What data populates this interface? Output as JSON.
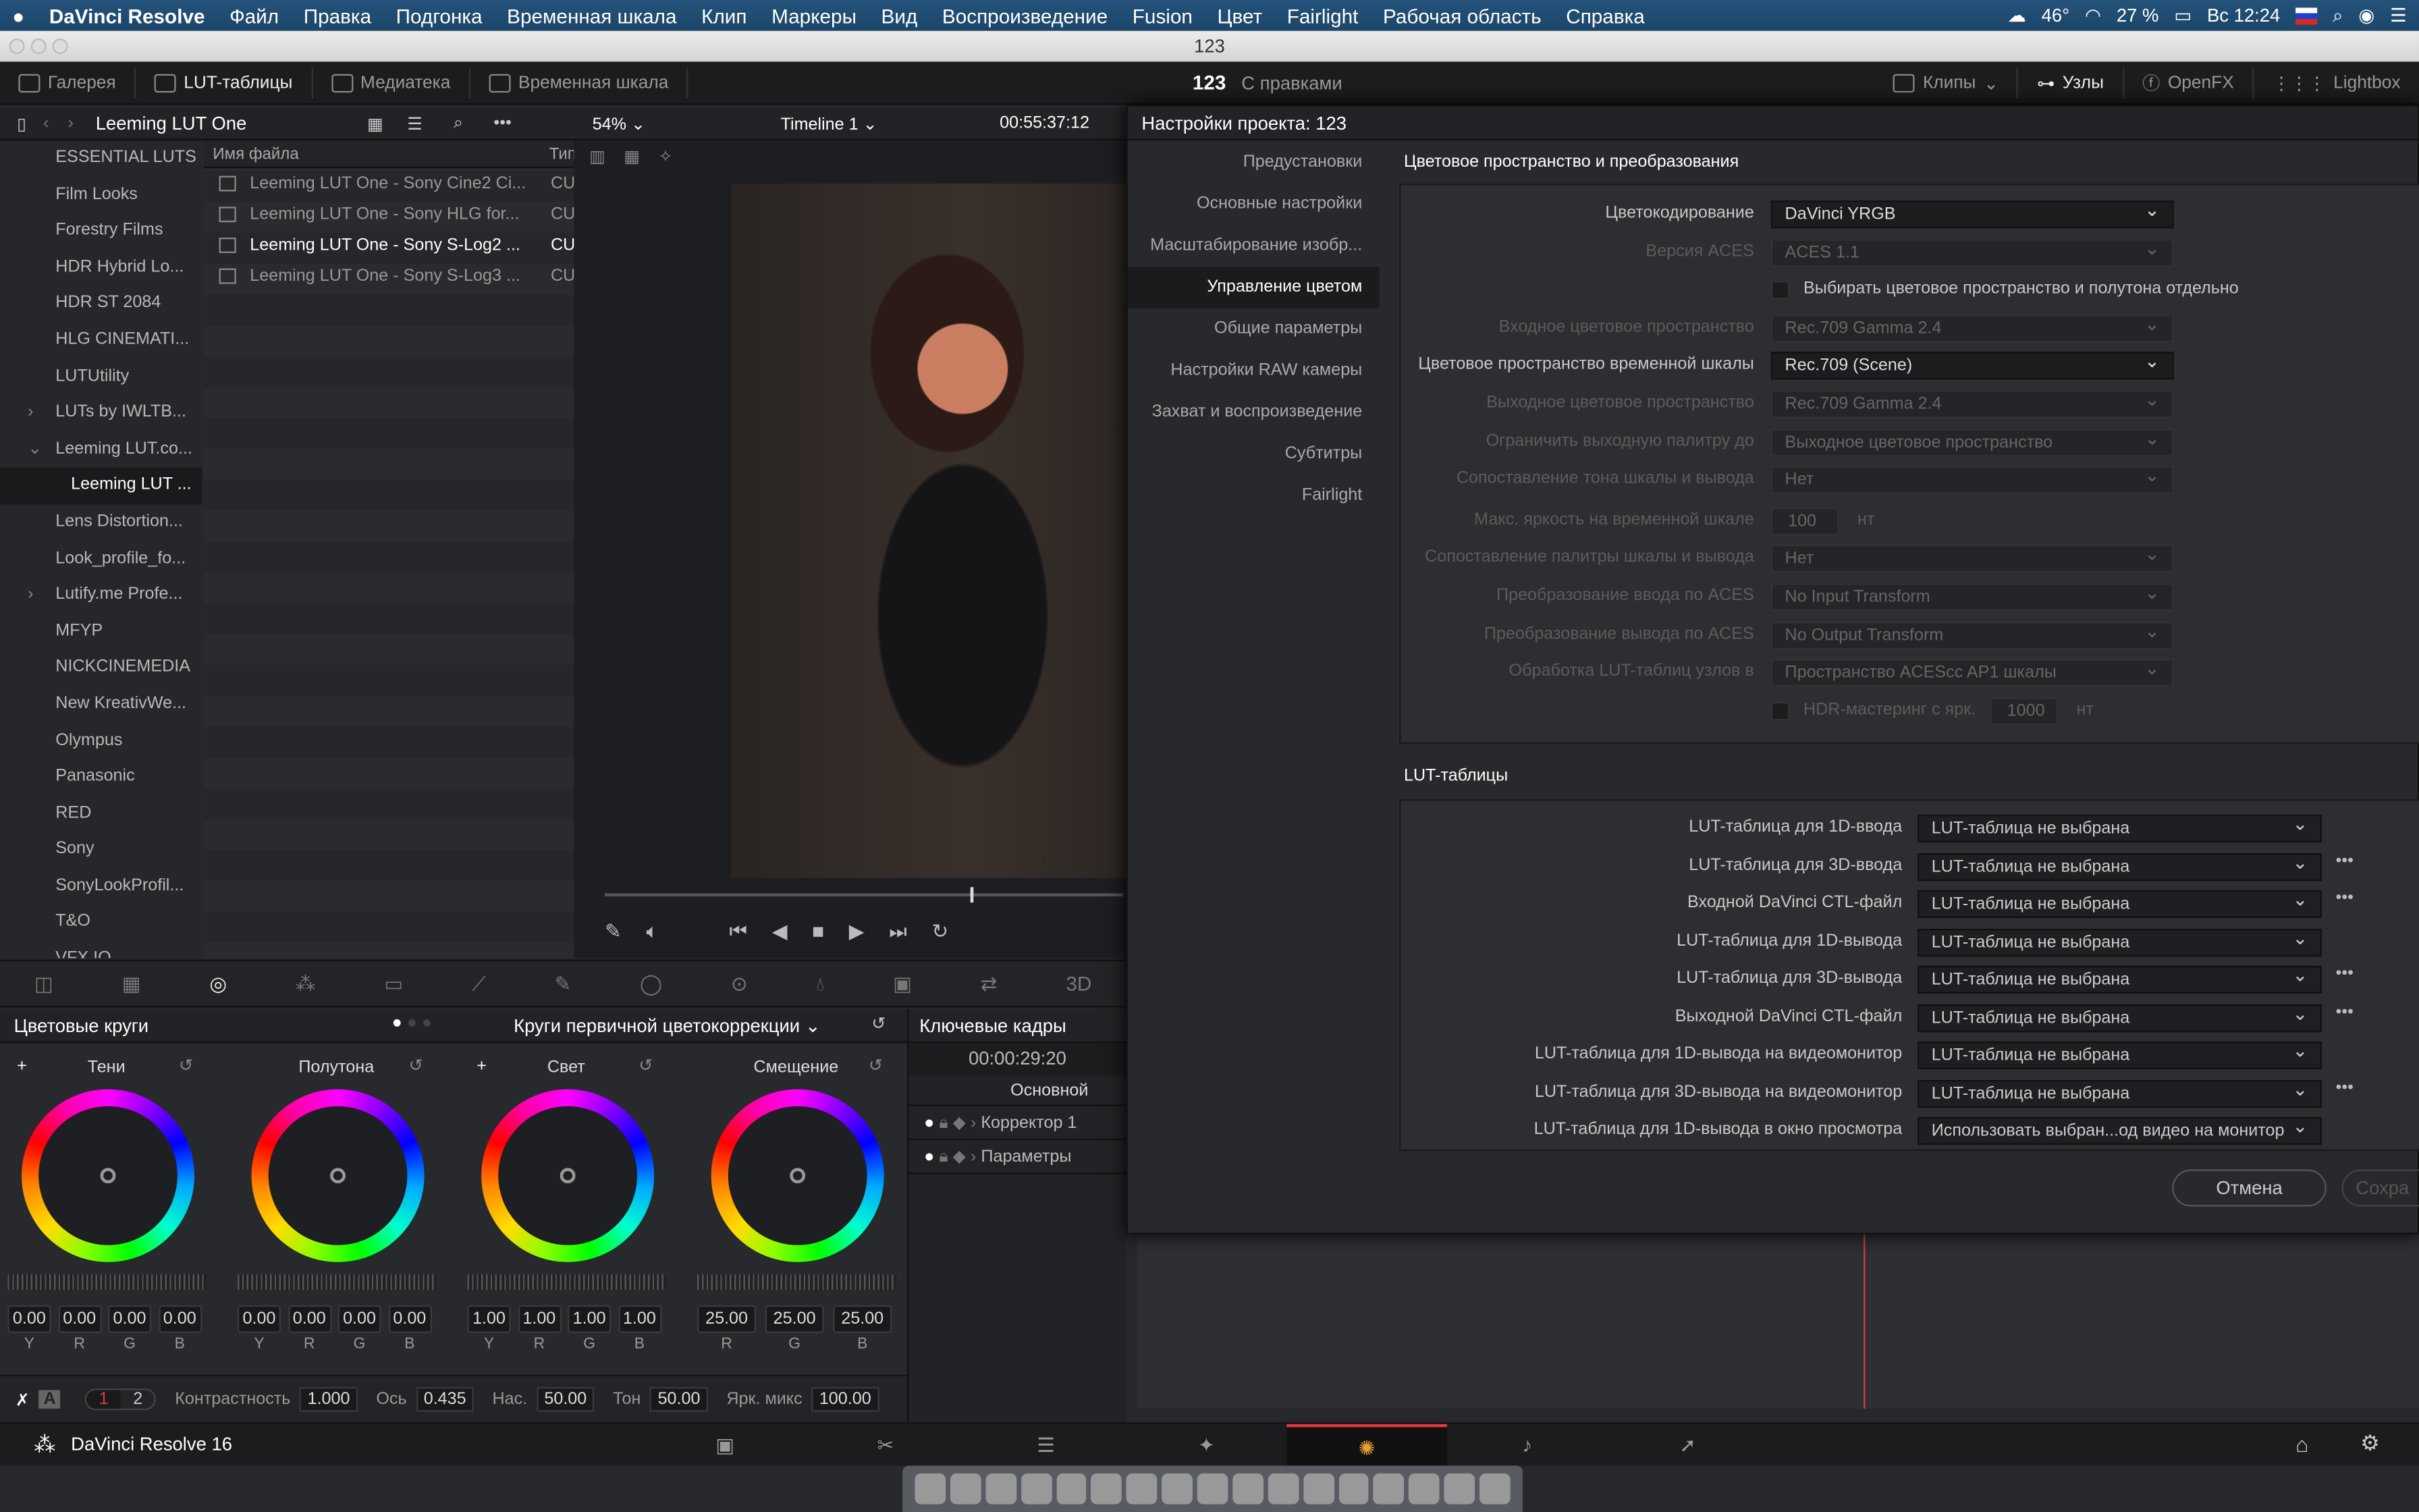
{
  "menubar": {
    "app": "DaVinci Resolve",
    "items": [
      "Файл",
      "Правка",
      "Подгонка",
      "Временная шкала",
      "Клип",
      "Маркеры",
      "Вид",
      "Воспроизведение",
      "Fusion",
      "Цвет",
      "Fairlight",
      "Рабочая область",
      "Справка"
    ],
    "temp": "46°",
    "battery": "27 %",
    "clock": "Вс 12:24"
  },
  "window": {
    "title": "123"
  },
  "toolbar": {
    "left": [
      "Галерея",
      "LUT-таблицы",
      "Медиатека",
      "Временная шкала"
    ],
    "project": "123",
    "status": "С правками",
    "right": [
      "Клипы",
      "Узлы",
      "OpenFX",
      "Lightbox"
    ]
  },
  "browser": {
    "title": "Leeming LUT One",
    "col_name": "Имя файла",
    "col_type": "Тип",
    "tree": [
      {
        "label": "ESSENTIAL LUTS"
      },
      {
        "label": "Film Looks"
      },
      {
        "label": "Forestry Films"
      },
      {
        "label": "HDR Hybrid Lo..."
      },
      {
        "label": "HDR ST 2084"
      },
      {
        "label": "HLG CINEMATI..."
      },
      {
        "label": "LUTUtility"
      },
      {
        "label": "LUTs by IWLTB...",
        "arrow": "›"
      },
      {
        "label": "Leeming LUT.co...",
        "arrow": "⌄"
      },
      {
        "label": "Leeming LUT ...",
        "selected": true
      },
      {
        "label": "Lens Distortion..."
      },
      {
        "label": "Look_profile_fo..."
      },
      {
        "label": "Lutify.me Profe...",
        "arrow": "›"
      },
      {
        "label": "MFYP"
      },
      {
        "label": "NICKCINEMEDIA"
      },
      {
        "label": "New KreativWe..."
      },
      {
        "label": "Olympus"
      },
      {
        "label": "Panasonic"
      },
      {
        "label": "RED"
      },
      {
        "label": "Sony"
      },
      {
        "label": "SonyLookProfil..."
      },
      {
        "label": "T&O"
      },
      {
        "label": "VFX IO"
      }
    ],
    "files": [
      {
        "name": "Leeming LUT One - Sony Cine2 Ci...",
        "type": "CU"
      },
      {
        "name": "Leeming LUT One - Sony HLG for...",
        "type": "CU"
      },
      {
        "name": "Leeming LUT One - Sony S-Log2 ...",
        "type": "CU",
        "selected": true
      },
      {
        "name": "Leeming LUT One - Sony S-Log3 ...",
        "type": "CU"
      }
    ]
  },
  "viewer": {
    "zoom": "54%",
    "timeline": "Timeline 1",
    "timecode": "00:55:37:12"
  },
  "wheels": {
    "title": "Цветовые круги",
    "mode": "Круги первичной цветокоррекции",
    "groups": [
      {
        "name": "Тени",
        "values": [
          "0.00",
          "0.00",
          "0.00",
          "0.00"
        ],
        "channels": [
          "Y",
          "R",
          "G",
          "B"
        ]
      },
      {
        "name": "Полутона",
        "values": [
          "0.00",
          "0.00",
          "0.00",
          "0.00"
        ],
        "channels": [
          "Y",
          "R",
          "G",
          "B"
        ]
      },
      {
        "name": "Свет",
        "values": [
          "1.00",
          "1.00",
          "1.00",
          "1.00"
        ],
        "channels": [
          "Y",
          "R",
          "G",
          "B"
        ]
      },
      {
        "name": "Смещение",
        "values": [
          "25.00",
          "25.00",
          "25.00"
        ],
        "channels": [
          "R",
          "G",
          "B"
        ]
      }
    ],
    "bottom": {
      "page1": "1",
      "page2": "2",
      "auto": "A",
      "params": [
        {
          "label": "Контрастность",
          "value": "1.000"
        },
        {
          "label": "Ось",
          "value": "0.435"
        },
        {
          "label": "Нас.",
          "value": "50.00"
        },
        {
          "label": "Тон",
          "value": "50.00"
        },
        {
          "label": "Ярк. микс",
          "value": "100.00"
        }
      ]
    }
  },
  "keyframes": {
    "title": "Ключевые кадры",
    "timecode": "00:00:29:20",
    "master": "Основной",
    "tracks": [
      "Корректор 1",
      "Параметры"
    ]
  },
  "dialog": {
    "title": "Настройки проекта: 123",
    "nav": [
      {
        "label": "Предустановки"
      },
      {
        "label": "Основные настройки"
      },
      {
        "label": "Масштабирование изобр..."
      },
      {
        "label": "Управление цветом",
        "selected": true
      },
      {
        "label": "Общие параметры"
      },
      {
        "label": "Настройки RAW камеры"
      },
      {
        "label": "Захват и воспроизведение"
      },
      {
        "label": "Субтитры"
      },
      {
        "label": "Fairlight"
      }
    ],
    "section1": "Цветовое пространство и преобразования",
    "rows": [
      {
        "label": "Цветокодирование",
        "value": "DaVinci YRGB",
        "enabled": true
      },
      {
        "label": "Версия ACES",
        "value": "ACES 1.1"
      },
      {
        "checkbox": "Выбирать цветовое пространство и полутона отдельно",
        "checked": false
      },
      {
        "label": "Входное цветовое пространство",
        "value": "Rec.709 Gamma 2.4"
      },
      {
        "label": "Цветовое пространство временной шкалы",
        "value": "Rec.709 (Scene)",
        "enabled": true
      },
      {
        "label": "Выходное цветовое пространство",
        "value": "Rec.709 Gamma 2.4"
      },
      {
        "label": "Ограничить выходную палитру до",
        "value": "Выходное цветовое пространство"
      },
      {
        "label": "Сопоставление тона шкалы и вывода",
        "value": "Нет"
      },
      {
        "label": "Макс. яркость на временной шкале",
        "field": "100",
        "unit": "нт"
      },
      {
        "label": "Сопоставление палитры шкалы и вывода",
        "value": "Нет"
      },
      {
        "label": "Преобразование ввода по ACES",
        "value": "No Input Transform"
      },
      {
        "label": "Преобразование вывода по ACES",
        "value": "No Output Transform"
      },
      {
        "label": "Обработка LUT-таблиц узлов в",
        "value": "Пространство ACEScc AP1 шкалы"
      },
      {
        "checkbox": "HDR-мастеринг с ярк.",
        "field": "1000",
        "unit": "нт",
        "checked": false
      }
    ],
    "section2": "LUT-таблицы",
    "luts": [
      {
        "label": "LUT-таблица для 1D-ввода",
        "value": "LUT-таблица не выбрана"
      },
      {
        "label": "LUT-таблица для 3D-ввода",
        "value": "LUT-таблица не выбрана",
        "more": true
      },
      {
        "label": "Входной DaVinci CTL-файл",
        "value": "LUT-таблица не выбрана",
        "more": true
      },
      {
        "label": "LUT-таблица для 1D-вывода",
        "value": "LUT-таблица не выбрана"
      },
      {
        "label": "LUT-таблица для 3D-вывода",
        "value": "LUT-таблица не выбрана",
        "more": true
      },
      {
        "label": "Выходной DaVinci CTL-файл",
        "value": "LUT-таблица не выбрана",
        "more": true
      },
      {
        "label": "LUT-таблица для 1D-вывода на видеомонитор",
        "value": "LUT-таблица не выбрана"
      },
      {
        "label": "LUT-таблица для 3D-вывода на видеомонитор",
        "value": "LUT-таблица не выбрана",
        "more": true
      },
      {
        "label": "LUT-таблица для 1D-вывода в окно просмотра",
        "value": "Использовать выбран...од видео на монитор"
      }
    ],
    "cancel": "Отмена",
    "save": "Сохра"
  },
  "pagebar": {
    "app": "DaVinci Resolve 16",
    "pages": [
      "media-icon",
      "cut-icon",
      "edit-icon",
      "fusion-icon",
      "color-icon",
      "fairlight-icon",
      "deliver-icon"
    ],
    "active": "color-icon"
  },
  "colors": {
    "accent_red": "#e23a3a",
    "menubar": "#1f4a6e"
  }
}
